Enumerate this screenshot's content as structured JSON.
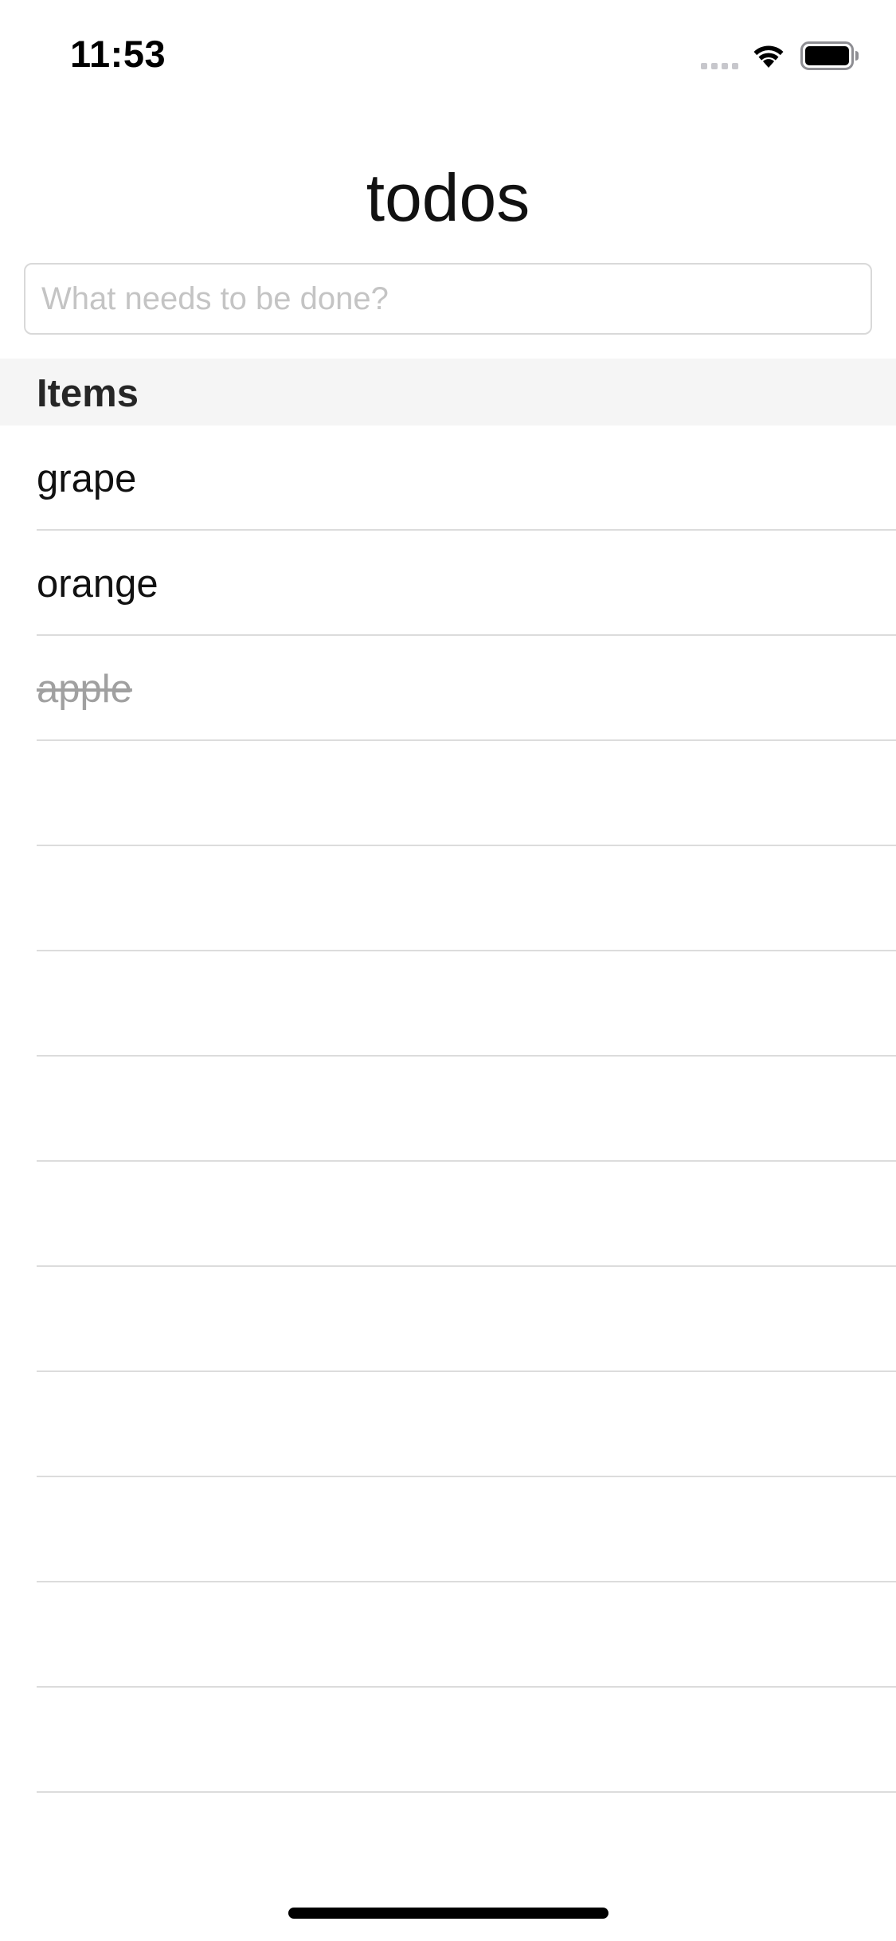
{
  "status_bar": {
    "time": "11:53",
    "signal_icon": "cellular-signal-icon",
    "wifi_icon": "wifi-icon",
    "battery_icon": "battery-icon"
  },
  "app": {
    "title": "todos"
  },
  "new_todo": {
    "placeholder": "What needs to be done?",
    "value": ""
  },
  "section": {
    "title": "Items"
  },
  "items": [
    {
      "label": "grape",
      "completed": false
    },
    {
      "label": "orange",
      "completed": false
    },
    {
      "label": "apple",
      "completed": true
    }
  ],
  "empty_rows": 10,
  "colors": {
    "text": "#111111",
    "completed_text": "#a0a0a0",
    "section_bg": "#f5f5f5",
    "divider": "#dcdcdc",
    "placeholder": "#c4c4c4"
  }
}
